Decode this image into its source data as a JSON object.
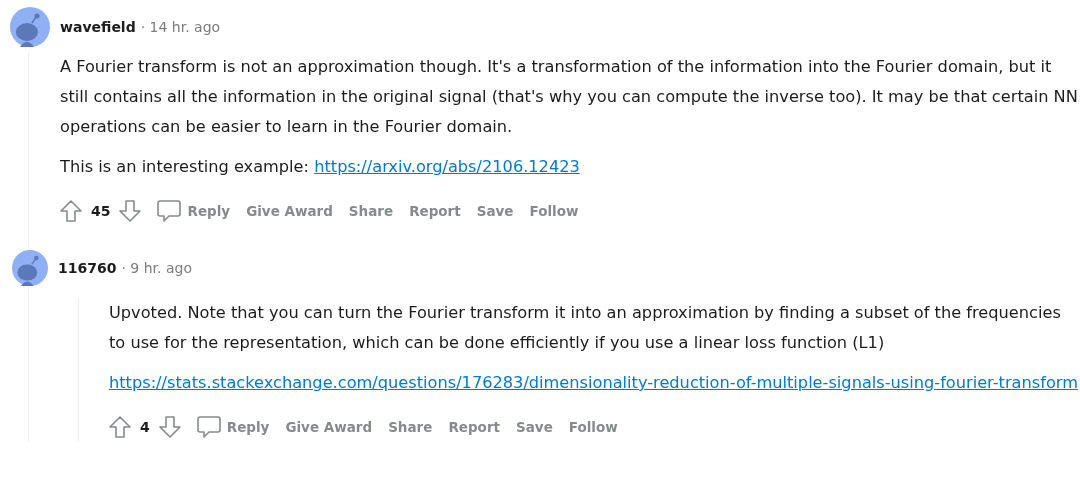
{
  "comments": [
    {
      "author": "wavefield",
      "time": "· 14 hr. ago",
      "paragraphs": [
        {
          "kind": "text",
          "text": "A Fourier transform is not an approximation though. It's a transformation of the information into the Fourier domain, but it still contains all the information in the original signal (that's why you can compute the inverse too). It may be that certain NN operations can be easier to learn in the Fourier domain."
        },
        {
          "kind": "text_link",
          "text": "This is an interesting example: ",
          "link": "https://arxiv.org/abs/2106.12423"
        }
      ],
      "votes": "45",
      "actions": [
        "Reply",
        "Give Award",
        "Share",
        "Report",
        "Save",
        "Follow"
      ],
      "children": [
        {
          "author": "116760",
          "time": "· 9 hr. ago",
          "paragraphs": [
            {
              "kind": "text",
              "text": "Upvoted. Note that you can turn the Fourier transform it into an approximation by finding a subset of the frequencies to use for the representation, which can be done efficiently if you use a linear loss function (L1)"
            },
            {
              "kind": "link",
              "link": "https://stats.stackexchange.com/questions/176283/dimensionality-reduction-of-multiple-signals-using-fourier-transform"
            }
          ],
          "votes": "4",
          "actions": [
            "Reply",
            "Give Award",
            "Share",
            "Report",
            "Save",
            "Follow"
          ]
        }
      ]
    }
  ]
}
